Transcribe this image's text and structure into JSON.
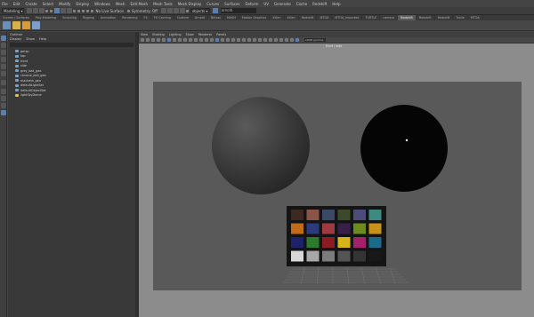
{
  "menubar": {
    "items": [
      "File",
      "Edit",
      "Create",
      "Select",
      "Modify",
      "Display",
      "Windows",
      "Mesh",
      "Edit Mesh",
      "Mesh Tools",
      "Mesh Display",
      "Curves",
      "Surfaces",
      "Deform",
      "UV",
      "Generate",
      "Cache",
      "Redshift",
      "Help"
    ]
  },
  "statusline": {
    "workspace": "Modeling",
    "no_live": "No Live Surface",
    "symmetry": "Symmetry: Off",
    "select_mode": "objects",
    "renderer": "arnold"
  },
  "shelf": {
    "tabs": [
      "Curves / Surfaces",
      "Poly Modeling",
      "Sculpting",
      "Rigging",
      "Animation",
      "Rendering",
      "FX",
      "FX Caching",
      "Custom",
      "Arnold",
      "Bifrost",
      "MASH",
      "Motion Graphics",
      "XGen",
      "XGen",
      "Redshift",
      "MTOA",
      "MTOA_imported",
      "TURTLE",
      "camera",
      "Redshift",
      "Redshift",
      "Redshift",
      "Turtle",
      "MTOA"
    ],
    "active_tab_index": 20,
    "icon_colors": [
      "#6c8fc0",
      "#d6b24a",
      "#d69b3a",
      "#7b9fc7"
    ]
  },
  "outliner": {
    "title": "Outliner",
    "menus": [
      "Display",
      "Show",
      "Help"
    ],
    "items": [
      {
        "label": "persp",
        "kind": "camera"
      },
      {
        "label": "top",
        "kind": "camera"
      },
      {
        "label": "front",
        "kind": "camera"
      },
      {
        "label": "side",
        "kind": "camera"
      },
      {
        "label": "grey_ball_geo",
        "kind": "mesh"
      },
      {
        "label": "chrome_ball_geo",
        "kind": "mesh"
      },
      {
        "label": "macbeth_geo",
        "kind": "mesh"
      },
      {
        "label": "defaultLightSet",
        "kind": "set"
      },
      {
        "label": "defaultObjectSet",
        "kind": "set"
      },
      {
        "label": "lightSkyDome",
        "kind": "light"
      }
    ]
  },
  "viewport": {
    "menus": [
      "View",
      "Shading",
      "Lighting",
      "Show",
      "Renderer",
      "Panels"
    ],
    "camera_label": "front / side",
    "colorspace": "sRGB gamma"
  },
  "macbeth": {
    "colors": [
      "#3c2a22",
      "#8a5446",
      "#3a4a66",
      "#3a4a2a",
      "#4b4c7a",
      "#3f8a80",
      "#c06a1c",
      "#2a3a7a",
      "#a03a42",
      "#3a1f48",
      "#6c8a1e",
      "#c8921a",
      "#1c236a",
      "#2c7a2c",
      "#8a1c22",
      "#d6b41a",
      "#a2206c",
      "#1c6a8a",
      "#d8d8d8",
      "#a8a8a8",
      "#7c7c7c",
      "#545454",
      "#343434",
      "#181818"
    ]
  }
}
